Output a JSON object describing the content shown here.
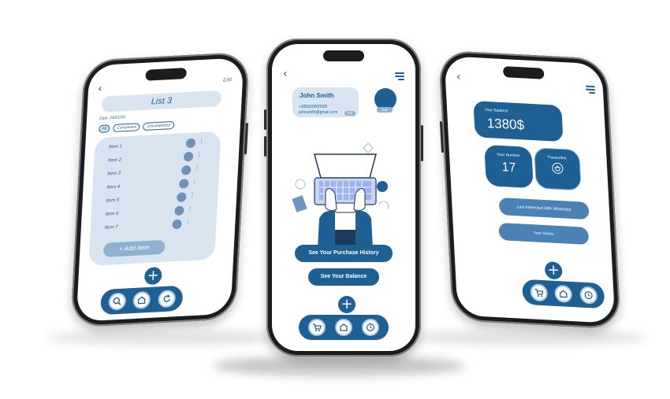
{
  "colors": {
    "primary": "#1e5f94",
    "light": "#d8e5f0",
    "muted": "#8eb1cf",
    "pill": "#4b82b5"
  },
  "left_screen": {
    "back_icon": "chevron-left-icon",
    "header_action": "List",
    "title": "List 3",
    "date": "Date: 28/01/25",
    "filters": [
      "All",
      "Completed",
      "Uncompleted"
    ],
    "items": [
      "Item 1",
      "Item 2",
      "Item 3",
      "Item 4",
      "Item 5",
      "Item 6",
      "Item 7"
    ],
    "add_button": "+ Add Item",
    "fab": "+",
    "nav_icons": [
      "search-icon",
      "home-icon",
      "refresh-icon"
    ]
  },
  "center_screen": {
    "back_icon": "chevron-left-icon",
    "menu_icon": "menu-icon",
    "profile": {
      "name": "John Smith",
      "phone": "+380000000000",
      "email": "johnsmith@gmail.com",
      "edit": "Edit"
    },
    "avatar_edit": "Edit",
    "illustration": "laptop-typing-illustration",
    "buttons": [
      "See Your Purchase History",
      "See Your Balance"
    ],
    "fab": "+",
    "nav_icons": [
      "cart-icon",
      "home-icon",
      "clock-icon"
    ]
  },
  "right_screen": {
    "back_icon": "chevron-left-icon",
    "menu_icon": "menu-icon",
    "balance_label": "Your Balance",
    "balance_value": "1380$",
    "number_label": "Your Number",
    "number_value": "17",
    "favourites_label": "Favourites",
    "favourites_icon": "basket-icon",
    "pill_1": "Last Interected With WhatsApp",
    "pill_2": "Your Stores",
    "fab": "+",
    "nav_icons": [
      "cart-icon",
      "home-icon",
      "clock-icon"
    ]
  }
}
